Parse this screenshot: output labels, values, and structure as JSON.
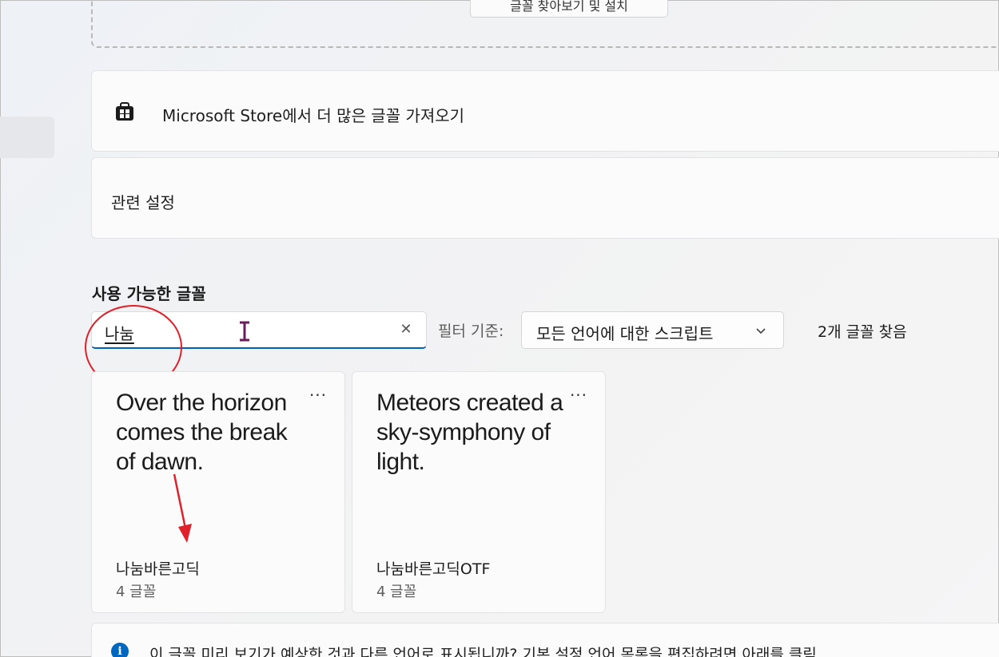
{
  "upload": {
    "browse_label": "글꼴 찾아보기 및 설치"
  },
  "store": {
    "icon": "store-icon",
    "label": "Microsoft Store에서 더 많은 글꼴 가져오기"
  },
  "related": {
    "label": "관련 설정"
  },
  "available_fonts": {
    "title": "사용 가능한 글꼴",
    "search": {
      "value": "나눔",
      "clear_glyph": "✕"
    },
    "filter": {
      "label": "필터 기준:",
      "selected": "모든 언어에 대한 스크립트"
    },
    "result_count": "2개 글꼴 찾음",
    "cards": [
      {
        "preview": "Over the horizon comes the break of dawn.",
        "name": "나눔바른고딕",
        "count": "4 글꼴",
        "more": "···"
      },
      {
        "preview": "Meteors created a sky-symphony of light.",
        "name": "나눔바른고딕OTF",
        "count": "4 글꼴",
        "more": "···"
      }
    ]
  },
  "info": {
    "icon_glyph": "i",
    "text": "이 글꼴 미리 보기가 예상한 것과 다른 언어로 표시됩니까? 기본 설정 언어 목록을 편집하려면 아래를 클릭"
  },
  "colors": {
    "accent": "#005fb8",
    "annotation": "#e0202a"
  }
}
